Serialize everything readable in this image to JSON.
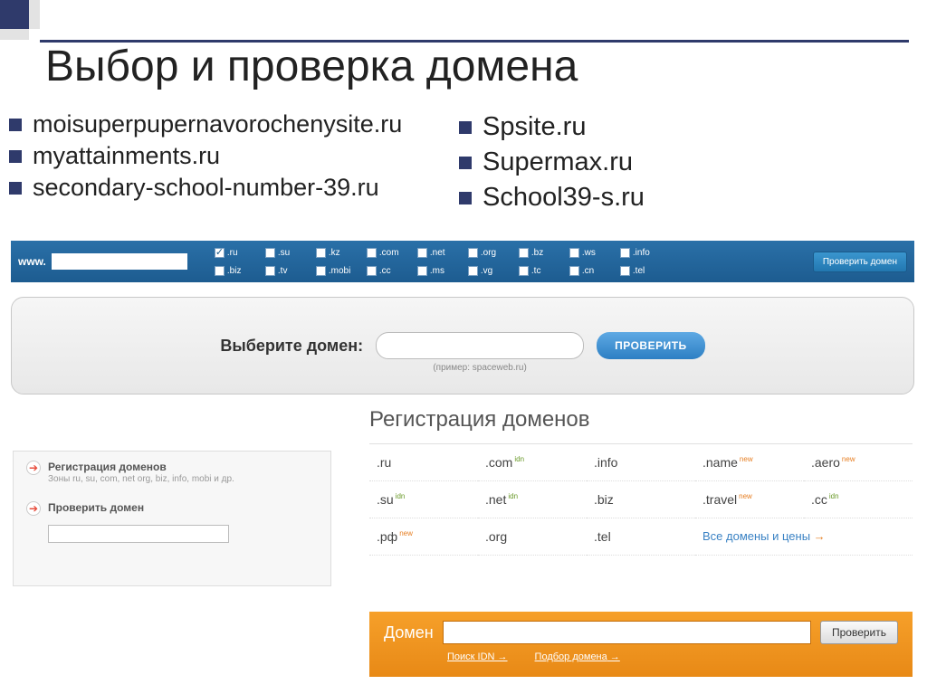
{
  "title": "Выбор и проверка домена",
  "left_items": [
    "moisuperpupernavorochenysite.ru",
    "myattainments.ru",
    "secondary-school-number-39.ru"
  ],
  "right_items": [
    "Spsite.ru",
    "Supermax.ru",
    "School39-s.ru"
  ],
  "blue_bar": {
    "www": "www.",
    "check_label": "Проверить домен",
    "tlds_row1": [
      {
        "label": ".ru",
        "checked": true
      },
      {
        "label": ".su",
        "checked": false
      },
      {
        "label": ".kz",
        "checked": false
      },
      {
        "label": ".com",
        "checked": false
      },
      {
        "label": ".net",
        "checked": false
      },
      {
        "label": ".org",
        "checked": false
      },
      {
        "label": ".bz",
        "checked": false
      },
      {
        "label": ".ws",
        "checked": false
      },
      {
        "label": ".info",
        "checked": false
      }
    ],
    "tlds_row2": [
      {
        "label": ".biz",
        "checked": false
      },
      {
        "label": ".tv",
        "checked": false
      },
      {
        "label": ".mobi",
        "checked": false
      },
      {
        "label": ".cc",
        "checked": false
      },
      {
        "label": ".ms",
        "checked": false
      },
      {
        "label": ".vg",
        "checked": false
      },
      {
        "label": ".tc",
        "checked": false
      },
      {
        "label": ".cn",
        "checked": false
      },
      {
        "label": ".tel",
        "checked": false
      }
    ]
  },
  "grey_panel": {
    "label": "Выберите домен:",
    "example": "(пример: spaceweb.ru)",
    "button": "ПРОВЕРИТЬ"
  },
  "reg_box": {
    "item1_title": "Регистрация доменов",
    "item1_sub": "Зоны ru, su, com, net org, biz, info, mobi и др.",
    "item2_title": "Проверить домен"
  },
  "dom_section": {
    "title": "Регистрация доменов",
    "cells": [
      {
        "tld": ".ru",
        "badge": ""
      },
      {
        "tld": ".com",
        "badge": "idn",
        "badge_class": "badge-g"
      },
      {
        "tld": ".info",
        "badge": ""
      },
      {
        "tld": ".name",
        "badge": "new"
      },
      {
        "tld": ".aero",
        "badge": "new"
      },
      {
        "tld": ".su",
        "badge": "idn",
        "badge_class": "badge-g"
      },
      {
        "tld": ".net",
        "badge": "idn",
        "badge_class": "badge-g"
      },
      {
        "tld": ".biz",
        "badge": ""
      },
      {
        "tld": ".travel",
        "badge": "new"
      },
      {
        "tld": ".cc",
        "badge": "idn",
        "badge_class": "badge-g"
      },
      {
        "tld": ".рф",
        "badge": "new"
      },
      {
        "tld": ".org",
        "badge": ""
      },
      {
        "tld": ".tel",
        "badge": ""
      }
    ],
    "all_link": "Все домены и цены",
    "all_arrow": "→"
  },
  "orange_bar": {
    "label": "Домен",
    "button": "Проверить",
    "link1": "Поиск IDN",
    "link2": "Подбор домена"
  }
}
